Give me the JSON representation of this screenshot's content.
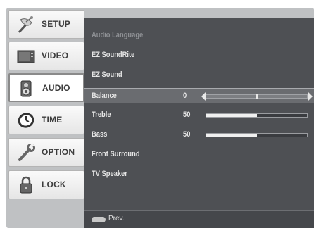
{
  "sidebar": {
    "items": [
      {
        "label": "SETUP",
        "icon": "satellite-dish-icon",
        "active": false
      },
      {
        "label": "VIDEO",
        "icon": "tv-screen-icon",
        "active": false
      },
      {
        "label": "AUDIO",
        "icon": "speaker-icon",
        "active": true
      },
      {
        "label": "TIME",
        "icon": "clock-icon",
        "active": false
      },
      {
        "label": "OPTION",
        "icon": "wrench-icon",
        "active": false
      },
      {
        "label": "LOCK",
        "icon": "padlock-icon",
        "active": false
      }
    ]
  },
  "menu": {
    "items": [
      {
        "label": "Audio Language",
        "disabled": true
      },
      {
        "label": "EZ SoundRite"
      },
      {
        "label": "EZ Sound"
      },
      {
        "label": "Balance",
        "value": "0",
        "selected": true,
        "control": "balance",
        "balance_level": 0
      },
      {
        "label": "Treble",
        "value": "50",
        "control": "slider",
        "level_percent": 50
      },
      {
        "label": "Bass",
        "value": "50",
        "control": "slider",
        "level_percent": 50
      },
      {
        "label": "Front Surround"
      },
      {
        "label": "TV Speaker"
      }
    ]
  },
  "footer": {
    "key_icon": "menu-key-icon",
    "prev_label": "Prev."
  },
  "colors": {
    "panel_bg": "#4e5054",
    "sidebar_frame": "#bfc1c3",
    "text": "#e6e6e6"
  }
}
